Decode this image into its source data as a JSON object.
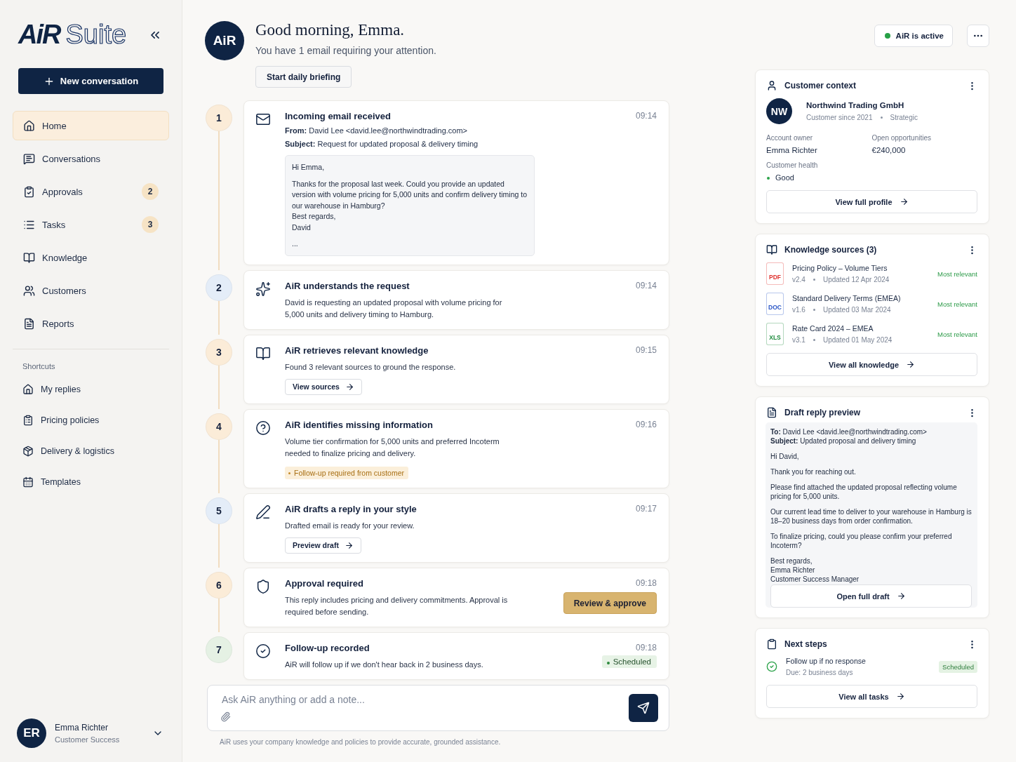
{
  "sidebar": {
    "logo": {
      "mark": "AiR",
      "name": "Suite"
    },
    "new_button": "New conversation",
    "nav": [
      {
        "label": "Home",
        "selected": true
      },
      {
        "label": "Conversations",
        "selected": false
      },
      {
        "label": "Approvals",
        "selected": false,
        "count": "2"
      },
      {
        "label": "Tasks",
        "selected": false,
        "count": "3"
      },
      {
        "label": "Knowledge",
        "selected": false
      },
      {
        "label": "Customers",
        "selected": false
      },
      {
        "label": "Reports",
        "selected": false
      }
    ],
    "shortcuts_title": "Shortcuts",
    "shortcuts": [
      {
        "label": "My replies"
      },
      {
        "label": "Pricing policies"
      },
      {
        "label": "Delivery & logistics"
      },
      {
        "label": "Templates"
      }
    ],
    "user": {
      "initials": "ER",
      "name": "Emma Richter",
      "role": "Customer Success"
    }
  },
  "header": {
    "avatar": "AiR",
    "greeting": "Good morning, Emma.",
    "subtitle": "You have 1 email requiring your attention.",
    "button": "Start daily briefing"
  },
  "status": {
    "label": "AiR is active",
    "active": true
  },
  "steps": [
    {
      "number": "1",
      "color": "#fbecd8",
      "title": "Incoming email received",
      "time": "09:14",
      "meta": [
        "**From:** David Lee <david.lee@northwindtrading.com>",
        "**Subject:** Request for updated proposal & delivery timing"
      ],
      "email": [
        [
          "Hi Emma,"
        ],
        [
          "Thanks for the proposal last week. Could you provide an updated version with volume pricing for 5,000 units and confirm delivery timing to our warehouse in Hamburg?",
          "Best regards,",
          "David"
        ],
        [
          "..."
        ]
      ]
    },
    {
      "number": "2",
      "color": "#e4edf8",
      "title": "AiR understands the request",
      "time": "09:14",
      "description": "David is requesting an updated proposal with volume pricing for 5,000 units and delivery timing to Hamburg."
    },
    {
      "number": "3",
      "color": "#fbecd8",
      "title": "AiR retrieves relevant knowledge",
      "time": "09:15",
      "description": "Found 3 relevant sources to ground the response.",
      "link_button": "View sources"
    },
    {
      "number": "4",
      "color": "#fbecd8",
      "title": "AiR identifies missing information",
      "time": "09:16",
      "description": "Volume tier confirmation for 5,000 units and preferred Incoterm needed to finalize pricing and delivery.",
      "note": "Follow-up required from customer"
    },
    {
      "number": "5",
      "color": "#e4edf8",
      "title": "AiR drafts a reply in your style",
      "time": "09:17",
      "description": "Drafted email is ready for your review.",
      "link_button": "Preview draft"
    },
    {
      "number": "6",
      "color": "#fbecd8",
      "title": "Approval required",
      "time": "09:18",
      "description": "This reply includes pricing and delivery commitments. Approval is required before sending.",
      "approve_button": "Review & approve"
    },
    {
      "number": "7",
      "color": "#e5f1e4",
      "title": "Follow-up recorded",
      "time": "09:18",
      "description": "AiR will follow up if we don't hear back in 2 business days.",
      "status": "Scheduled"
    }
  ],
  "composer": {
    "placeholder": "Ask AiR anything or add a note...",
    "footnote": "AiR uses your company knowledge and policies to provide accurate, grounded assistance."
  },
  "customer": {
    "title": "Customer context",
    "initials": "NW",
    "company": "Northwind Trading GmbH",
    "since": "Customer since 2021",
    "segment": "Strategic",
    "fields": [
      {
        "label": "Account owner",
        "value": "Emma Richter"
      },
      {
        "label": "Open opportunities",
        "value": "€240,000"
      }
    ],
    "health_label": "Customer health",
    "health": "Good",
    "button": "View full profile"
  },
  "knowledge": {
    "title": "Knowledge sources (3)",
    "sources": [
      {
        "kind": "pdf",
        "type_label": "PDF",
        "name": "Pricing Policy – Volume Tiers",
        "version": "v2.4",
        "updated": "Updated 12 Apr 2024",
        "relevance": "Most relevant"
      },
      {
        "kind": "doc",
        "type_label": "DOC",
        "name": "Standard Delivery Terms (EMEA)",
        "version": "v1.6",
        "updated": "Updated 03 Mar 2024",
        "relevance": "Most relevant"
      },
      {
        "kind": "xls",
        "type_label": "XLS",
        "name": "Rate Card 2024 – EMEA",
        "version": "v3.1",
        "updated": "Updated 01 May 2024",
        "relevance": "Most relevant"
      }
    ],
    "button": "View all knowledge"
  },
  "draft": {
    "title": "Draft reply preview",
    "meta": [
      "**To:** David Lee <david.lee@northwindtrading.com>",
      "**Subject:** Updated proposal and delivery timing"
    ],
    "paragraphs": [
      [
        "Hi David,"
      ],
      [
        "Thank you for reaching out."
      ],
      [
        "Please find attached the updated proposal reflecting volume pricing for 5,000 units."
      ],
      [
        "Our current lead time to deliver to your warehouse in Hamburg is 18–20 business days from order confirmation."
      ],
      [
        "To finalize pricing, could you please confirm your preferred Incoterm?"
      ],
      [
        "Best regards,",
        "Emma Richter",
        "Customer Success Manager"
      ]
    ],
    "button": "Open full draft"
  },
  "next_steps": {
    "title": "Next steps",
    "tasks": [
      {
        "title": "Follow up if no response",
        "due": "Due: 2 business days",
        "status": "Scheduled"
      }
    ],
    "button": "View all tasks"
  }
}
